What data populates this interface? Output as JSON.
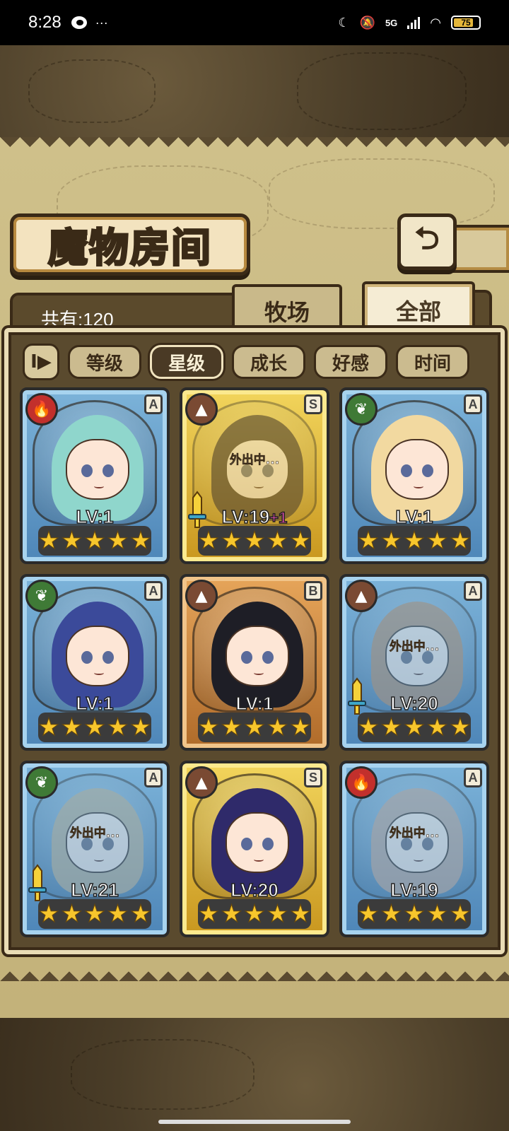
{
  "status_bar": {
    "time": "8:28",
    "dots": "···",
    "network": "5G",
    "battery": "75"
  },
  "header": {
    "title": "魔物房间",
    "back_icon": "return-arrow-icon"
  },
  "tabs": {
    "count_label": "共有:120",
    "farm": "牧场",
    "all": "全部",
    "active": "全部"
  },
  "sort": {
    "toggle_label": "I▶",
    "options": [
      "等级",
      "星级",
      "成长",
      "好感",
      "时间"
    ],
    "active": "星级"
  },
  "cards": [
    {
      "element": "fire",
      "rank": "A",
      "level": "LV:1",
      "bonus": "",
      "away": "",
      "frame": "blue",
      "stars": 5,
      "equipped": false,
      "hair": "#8fd6cc"
    },
    {
      "element": "earth",
      "rank": "S",
      "level": "LV:19",
      "bonus": "+1",
      "away": "外出中...",
      "frame": "gold",
      "stars": 5,
      "equipped": true,
      "hair": "#4a3326"
    },
    {
      "element": "leaf",
      "rank": "A",
      "level": "LV:1",
      "bonus": "",
      "away": "",
      "frame": "blue",
      "stars": 5,
      "equipped": false,
      "hair": "#f2d9a0"
    },
    {
      "element": "leaf",
      "rank": "A",
      "level": "LV:1",
      "bonus": "",
      "away": "",
      "frame": "blue",
      "stars": 5,
      "equipped": false,
      "hair": "#3b4a9a"
    },
    {
      "element": "earth",
      "rank": "B",
      "level": "LV:1",
      "bonus": "",
      "away": "",
      "frame": "bronze",
      "stars": 5,
      "equipped": false,
      "hair": "#1e1e26"
    },
    {
      "element": "earth",
      "rank": "A",
      "level": "LV:20",
      "bonus": "",
      "away": "外出中...",
      "frame": "blue",
      "stars": 5,
      "equipped": true,
      "hair": "#d08848"
    },
    {
      "element": "leaf",
      "rank": "A",
      "level": "LV:21",
      "bonus": "",
      "away": "外出中...",
      "frame": "blue",
      "stars": 5,
      "equipped": true,
      "hair": "#b8ae7a"
    },
    {
      "element": "earth",
      "rank": "S",
      "level": "LV:20",
      "bonus": "",
      "away": "",
      "frame": "gold",
      "stars": 5,
      "equipped": false,
      "hair": "#2f2a6a"
    },
    {
      "element": "fire",
      "rank": "A",
      "level": "LV:19",
      "bonus": "",
      "away": "外出中...",
      "frame": "blue",
      "stars": 5,
      "equipped": false,
      "hair": "#c9a08a"
    }
  ],
  "colors": {
    "parchment": "#cfc08a",
    "frame_dark": "#3a2a17",
    "star": "#f7c62c",
    "bonus": "#e64fb0"
  }
}
